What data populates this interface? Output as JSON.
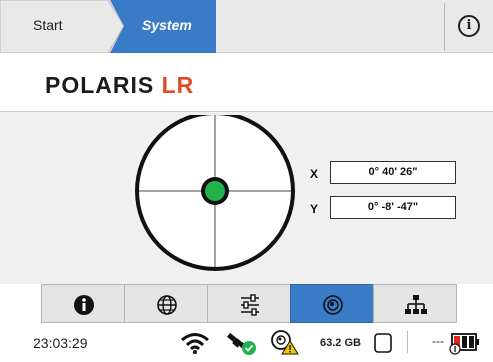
{
  "header": {
    "crumbs": [
      {
        "label": "Start",
        "active": false
      },
      {
        "label": "System",
        "active": true
      }
    ],
    "info_icon": "info-circle-icon",
    "info_glyph": "i"
  },
  "logo": {
    "brand_main": "POLARIS",
    "brand_suffix": "LR",
    "accent": "#e04a23"
  },
  "level": {
    "x_label": "X",
    "x_value": "0° 40' 26\"",
    "y_label": "Y",
    "y_value": "0° -8' -47\"",
    "bubble_color": "#22b24c"
  },
  "nav": {
    "tabs": [
      {
        "icon": "info-icon",
        "active": false
      },
      {
        "icon": "globe-icon",
        "active": false
      },
      {
        "icon": "sliders-icon",
        "active": false
      },
      {
        "icon": "level-target-icon",
        "active": true
      },
      {
        "icon": "network-icon",
        "active": false
      }
    ],
    "active_color": "#3a7bc8"
  },
  "status": {
    "time": "23:03:29",
    "storage": "63.2 GB",
    "signal": "---",
    "icons": [
      "wifi-icon",
      "satellite-ok-icon",
      "disc-warning-icon",
      "storage-icon",
      "battery-low-icon"
    ]
  }
}
